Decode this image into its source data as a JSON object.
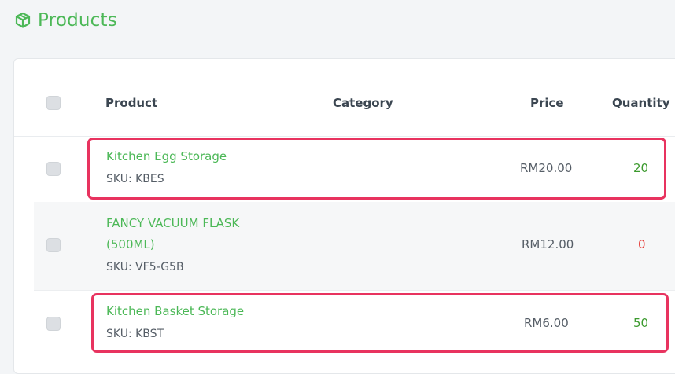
{
  "page": {
    "title": "Products",
    "icon": "box-icon"
  },
  "table": {
    "columns": [
      "Product",
      "Category",
      "Price",
      "Quantity"
    ],
    "rows": [
      {
        "name_lines": [
          "Kitchen Egg Storage"
        ],
        "sku_label": "SKU:",
        "sku": "KBES",
        "category": "",
        "price": "RM20.00",
        "quantity": "20",
        "quantity_color": "#3c9a2e",
        "highlighted": true
      },
      {
        "name_lines": [
          "FANCY VACUUM FLASK",
          "(500ML)"
        ],
        "sku_label": "SKU:",
        "sku": "VF5-G5B",
        "category": "",
        "price": "RM12.00",
        "quantity": "0",
        "quantity_color": "#e53935",
        "highlighted": false
      },
      {
        "name_lines": [
          "Kitchen Basket Storage"
        ],
        "sku_label": "SKU:",
        "sku": "KBST",
        "category": "",
        "price": "RM6.00",
        "quantity": "50",
        "quantity_color": "#3c9a2e",
        "highlighted": true
      }
    ]
  },
  "colors": {
    "accent": "#4cb857",
    "highlight": "#e8335f",
    "background": "#f3f5f7"
  }
}
